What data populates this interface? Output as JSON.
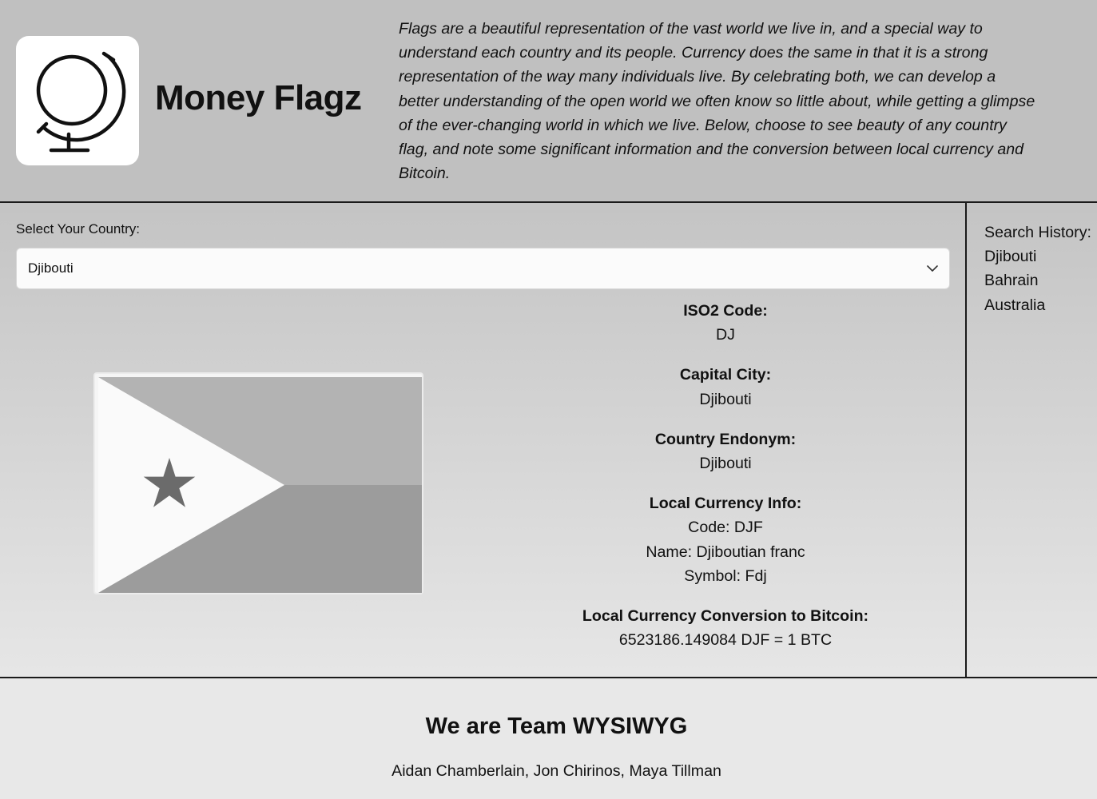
{
  "header": {
    "title": "Money Flagz",
    "logo_icon": "globe-icon",
    "intro": "Flags are a beautiful representation of the vast world we live in, and a special way to understand each country and its people. Currency does the same in that it is a strong representation of the way many individuals live. By celebrating both, we can develop a better understanding of the open world we often know so little about, while getting a glimpse of the ever-changing world in which we live. Below, choose to see beauty of any country flag, and note some significant information and the conversion between local currency and Bitcoin."
  },
  "selector": {
    "label": "Select Your Country:",
    "value": "Djibouti",
    "icon": "chevron-down-icon"
  },
  "flag": {
    "country": "Djibouti",
    "colors": {
      "top": "#b3b3b3",
      "bottom": "#9c9c9c",
      "triangle": "#fafafa",
      "star": "#6b6b6b"
    }
  },
  "info": {
    "iso_label": "ISO2 Code:",
    "iso_value": "DJ",
    "capital_label": "Capital City:",
    "capital_value": "Djibouti",
    "endonym_label": "Country Endonym:",
    "endonym_value": "Djibouti",
    "currency_label": "Local Currency Info:",
    "currency_code": "Code: DJF",
    "currency_name": "Name: Djiboutian franc",
    "currency_symbol": "Symbol: Fdj",
    "conversion_label": "Local Currency Conversion to Bitcoin:",
    "conversion_value": "6523186.149084 DJF = 1 BTC"
  },
  "history": {
    "label": "Search History:",
    "items": [
      "Djibouti",
      "Bahrain",
      "Australia"
    ]
  },
  "footer": {
    "title": "We are Team WYSIWYG",
    "members": "Aidan Chamberlain, Jon Chirinos, Maya Tillman"
  }
}
